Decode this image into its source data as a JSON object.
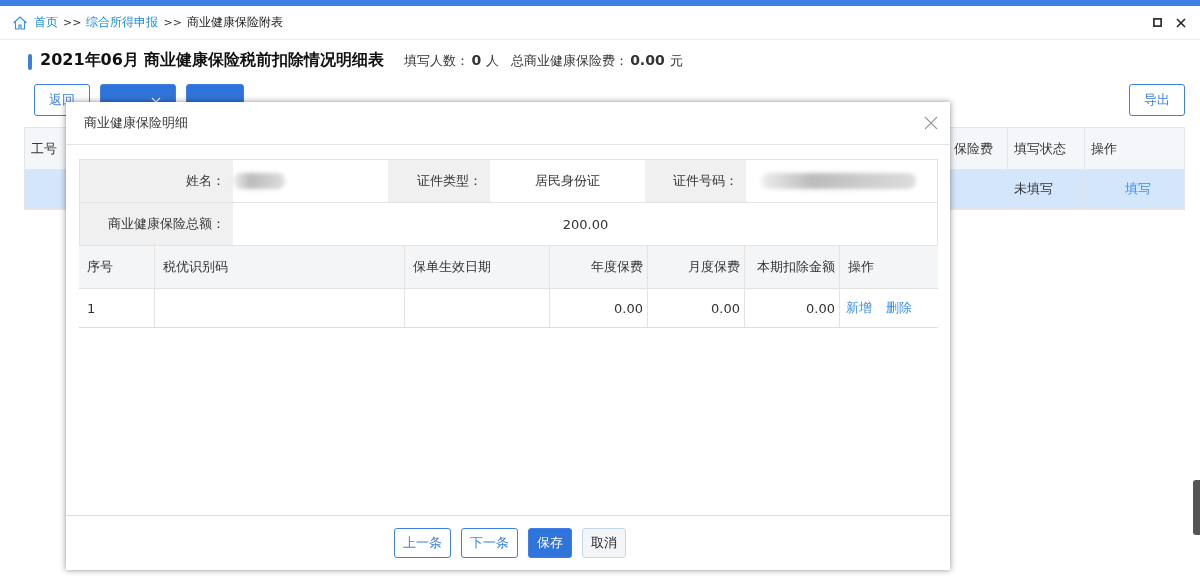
{
  "breadcrumb": [
    {
      "label": "首页",
      "kind": "link"
    },
    {
      "label": ">>",
      "kind": "separator"
    },
    {
      "label": "综合所得申报",
      "kind": "link"
    },
    {
      "label": ">>",
      "kind": "separator"
    },
    {
      "label": "商业健康保险附表",
      "kind": "current"
    }
  ],
  "page": {
    "title": "2021年06月 商业健康保险税前扣除情况明细表",
    "stats": [
      {
        "label": "填写人数：",
        "value": "0",
        "unit": "人"
      },
      {
        "label": "总商业健康保险费：",
        "value": "0.00",
        "unit": "元"
      }
    ]
  },
  "toolbar": [
    {
      "label": "返回",
      "kind": "outline"
    },
    {
      "kind": "dropdown"
    },
    {
      "kind": "primary"
    }
  ],
  "export_button": "导出",
  "table": {
    "columns": [
      "工号",
      "保险费",
      "填写状态",
      "操作"
    ],
    "rows": [
      {
        "selected": true,
        "status": "未填写",
        "action": "填写"
      }
    ]
  },
  "dialog": {
    "title": "商业健康保险明细",
    "fields": [
      {
        "label": "姓名：",
        "kind": "redacted"
      },
      {
        "label": "证件类型：",
        "kind": "text",
        "value": "居民身份证"
      },
      {
        "label": "证件号码：",
        "kind": "redacted"
      }
    ],
    "total": {
      "label": "商业健康保险总额：",
      "value": "200.00"
    },
    "columns": [
      "序号",
      "税优识别码",
      "保单生效日期",
      "年度保费",
      "月度保费",
      "本期扣除金额",
      "操作"
    ],
    "rows": [
      {
        "index": "1",
        "code": "",
        "date": "",
        "annual": "0.00",
        "monthly": "0.00",
        "deduction": "0.00",
        "actions": [
          "新增",
          "删除"
        ]
      }
    ],
    "buttons": [
      {
        "label": "上一条",
        "kind": "outline"
      },
      {
        "label": "下一条",
        "kind": "outline"
      },
      {
        "label": "保存",
        "kind": "primary"
      },
      {
        "label": "取消",
        "kind": "default"
      }
    ]
  }
}
